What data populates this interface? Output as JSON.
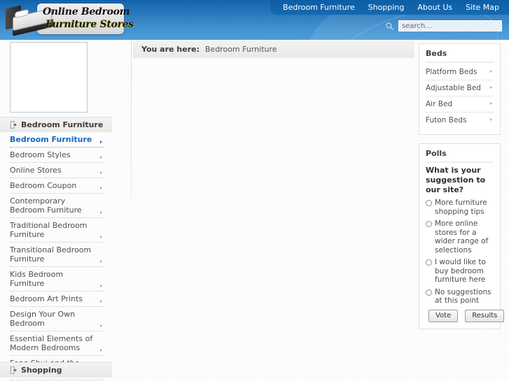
{
  "header": {
    "logo": {
      "line1": "Online Bedroom",
      "line2": "Furniture Stores",
      "bed_icon": "bed-icon"
    },
    "nav": [
      {
        "label": "Bedroom Furniture"
      },
      {
        "label": "Shopping"
      },
      {
        "label": "About Us"
      },
      {
        "label": "Site Map"
      }
    ],
    "search": {
      "placeholder": "search...",
      "value": "",
      "icon": "search-icon"
    }
  },
  "left_sidebar": {
    "sections": [
      {
        "title": "Bedroom Furniture",
        "icon": "doc-arrow-icon",
        "items": [
          {
            "label": "Bedroom Furniture",
            "active": true
          },
          {
            "label": "Bedroom Styles",
            "active": false
          },
          {
            "label": "Online Stores",
            "active": false
          },
          {
            "label": "Bedroom Coupon",
            "active": false
          },
          {
            "label": "Contemporary Bedroom Furniture",
            "active": false
          },
          {
            "label": "Traditional Bedroom Furniture",
            "active": false
          },
          {
            "label": "Transitional Bedroom Furniture",
            "active": false
          },
          {
            "label": "Kids Bedroom Furniture",
            "active": false
          },
          {
            "label": "Bedroom Art Prints",
            "active": false
          },
          {
            "label": "Design Your Own Bedroom",
            "active": false
          },
          {
            "label": "Essential Elements of Modern Bedrooms",
            "active": false
          },
          {
            "label": "Feng Shui and the Bedroom",
            "active": false
          }
        ]
      },
      {
        "title": "Shopping",
        "icon": "doc-arrow-icon",
        "items": []
      }
    ]
  },
  "main": {
    "breadcrumb": {
      "label": "You are here:",
      "current": "Bedroom Furniture"
    }
  },
  "right_sidebar": {
    "beds_panel": {
      "title": "Beds",
      "links": [
        {
          "label": "Platform Beds"
        },
        {
          "label": "Adjustable Bed"
        },
        {
          "label": "Air Bed"
        },
        {
          "label": "Futon Beds"
        }
      ]
    },
    "polls_panel": {
      "title": "Polls",
      "question": "What is your suggestion to our site?",
      "options": [
        {
          "label": "More furniture shopping tips",
          "selected": false
        },
        {
          "label": "More online stores for a wider range of selections",
          "selected": false
        },
        {
          "label": "I would like to buy bedroom furniture here",
          "selected": false
        },
        {
          "label": "No suggestions at this point",
          "selected": false
        }
      ],
      "vote_label": "Vote",
      "results_label": "Results"
    }
  },
  "colors": {
    "header_top": "#1060a8",
    "header_bottom": "#4c9bd6",
    "nav_bar": "#0d5ea6",
    "active_link": "#1566c0",
    "page_bg": "#fcfcfc",
    "panel_border": "#e0e0e0"
  }
}
